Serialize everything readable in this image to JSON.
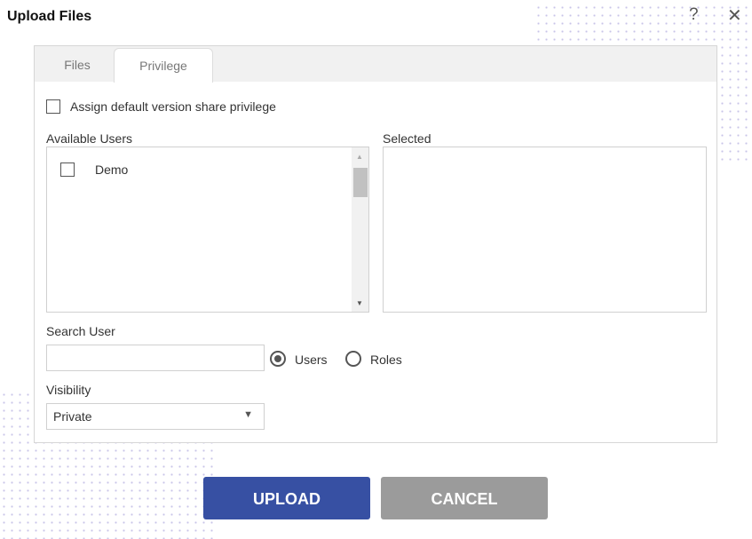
{
  "dialog": {
    "title": "Upload Files",
    "help_icon": "?",
    "close_icon": "✕"
  },
  "tabs": [
    {
      "label": "Files",
      "active": false
    },
    {
      "label": "Privilege",
      "active": true
    }
  ],
  "privilege": {
    "assign_default_label": "Assign default version share privilege",
    "assign_default_checked": false,
    "available_label": "Available Users",
    "available_users": [
      {
        "name": "Demo",
        "checked": false
      }
    ],
    "selected_label": "Selected",
    "search_label": "Search User",
    "search_value": "",
    "search_placeholder": "",
    "radio_users": "Users",
    "radio_roles": "Roles",
    "radio_selected": "Users",
    "visibility_label": "Visibility",
    "visibility_value": "Private"
  },
  "buttons": {
    "upload": "UPLOAD",
    "cancel": "CANCEL"
  },
  "colors": {
    "upload": "#3750a3",
    "cancel": "#9b9b9b"
  }
}
